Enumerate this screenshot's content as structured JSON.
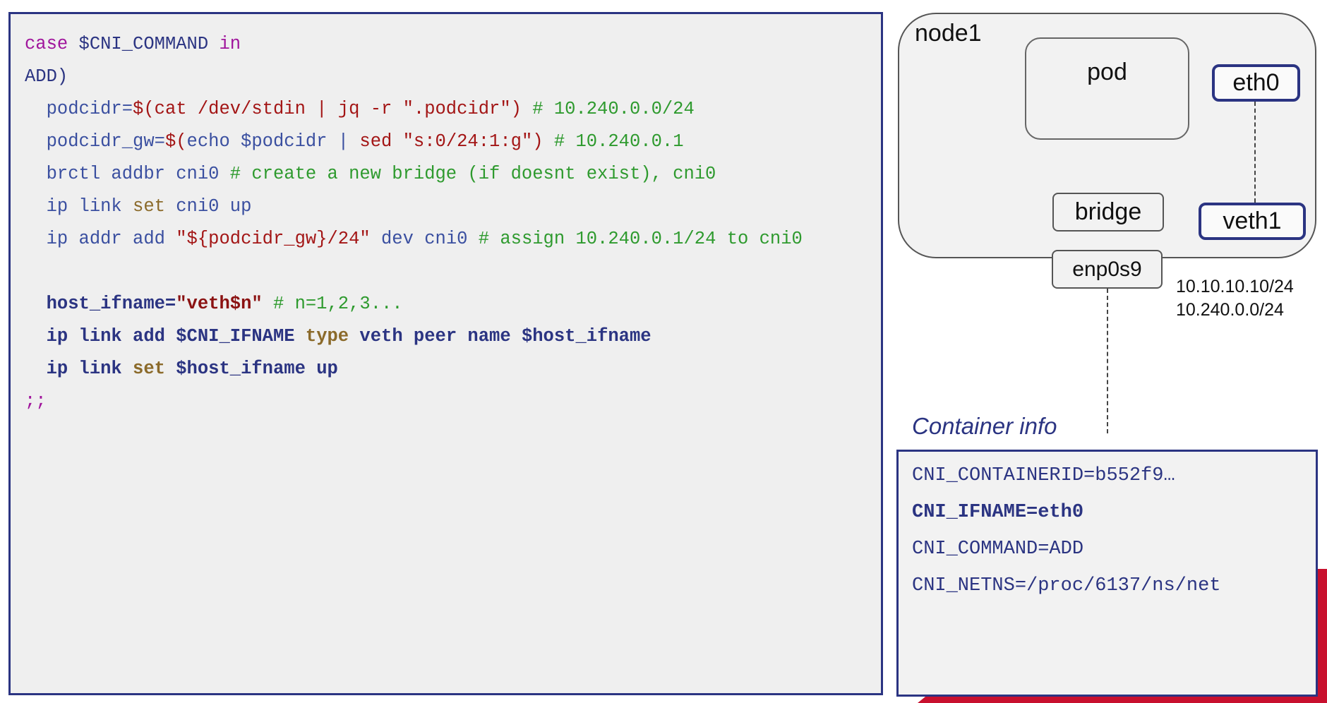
{
  "code": {
    "lines": [
      [
        {
          "t": "case",
          "c": "kw"
        },
        {
          "t": " $CNI_COMMAND ",
          "c": "va"
        },
        {
          "t": "in",
          "c": "kw"
        }
      ],
      [
        {
          "t": "ADD)",
          "c": "va"
        }
      ],
      [
        {
          "t": "  podcidr=",
          "c": "pl"
        },
        {
          "t": "$(cat /dev/stdin | ",
          "c": "st"
        },
        {
          "t": "jq -r \".podcidr\")",
          "c": "st"
        },
        {
          "t": " # 10.240.0.0/24",
          "c": "cm"
        }
      ],
      [
        {
          "t": "  podcidr_gw=",
          "c": "pl"
        },
        {
          "t": "$(",
          "c": "st"
        },
        {
          "t": "echo $podcidr",
          "c": "pl"
        },
        {
          "t": " | ",
          "c": "pl"
        },
        {
          "t": "sed \"s:0/24:1:g\")",
          "c": "st"
        },
        {
          "t": " # 10.240.0.1",
          "c": "cm"
        }
      ],
      [
        {
          "t": "  brctl addbr cni0 ",
          "c": "pl"
        },
        {
          "t": "# create a new bridge (if doesnt exist), cni0",
          "c": "cm"
        }
      ],
      [
        {
          "t": "  ip link ",
          "c": "pl"
        },
        {
          "t": "set",
          "c": "bi"
        },
        {
          "t": " cni0 up",
          "c": "pl"
        }
      ],
      [
        {
          "t": "  ip addr add ",
          "c": "pl"
        },
        {
          "t": "\"${podcidr_gw}/24\"",
          "c": "st"
        },
        {
          "t": " dev cni0 ",
          "c": "pl"
        },
        {
          "t": "# assign 10.240.0.1/24 to cni0",
          "c": "cm"
        }
      ],
      [
        {
          "t": " ",
          "c": "pl"
        }
      ],
      [
        {
          "t": "  host_ifname=",
          "c": "va",
          "b": true
        },
        {
          "t": "\"veth$n\"",
          "c": "dr",
          "b": true
        },
        {
          "t": " # n=1,2,3...",
          "c": "cm"
        }
      ],
      [
        {
          "t": "  ip link add ",
          "c": "va",
          "b": true
        },
        {
          "t": "$CNI_IFNAME ",
          "c": "va",
          "b": true
        },
        {
          "t": "type",
          "c": "bi",
          "b": true
        },
        {
          "t": " veth peer name ",
          "c": "va",
          "b": true
        },
        {
          "t": "$host_ifname",
          "c": "va",
          "b": true
        }
      ],
      [
        {
          "t": "  ip link ",
          "c": "va",
          "b": true
        },
        {
          "t": "set",
          "c": "bi",
          "b": true
        },
        {
          "t": " $host_ifname up",
          "c": "va",
          "b": true
        }
      ],
      [
        {
          "t": ";;",
          "c": "kw"
        }
      ]
    ]
  },
  "diagram": {
    "node_label": "node1",
    "pod_label": "pod",
    "eth0_label": "eth0",
    "veth1_label": "veth1",
    "bridge_label": "bridge",
    "enp_label": "enp0s9",
    "ip_lines": [
      "10.10.10.10/24",
      "10.240.0.0/24"
    ]
  },
  "container_info": {
    "title": "Container info",
    "lines": [
      "CNI_CONTAINERID=b552f9…",
      "CNI_IFNAME=eth0",
      "CNI_COMMAND=ADD",
      "CNI_NETNS=/proc/6137/ns/net"
    ]
  },
  "colors": {
    "border_blue": "#2b3482",
    "accent_red": "#c8102e"
  }
}
